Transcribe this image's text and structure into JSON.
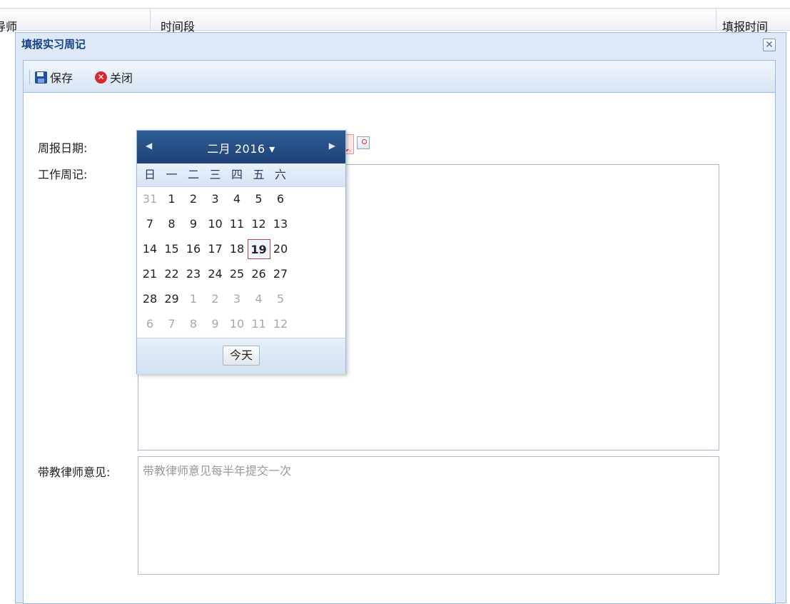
{
  "grid": {
    "columns": [
      "导师",
      "时间段",
      "填报时间"
    ]
  },
  "dialog": {
    "title": "填报实习周记",
    "toolbar": {
      "save_label": "保存",
      "close_label": "关闭"
    },
    "fields": {
      "date_label": "周报日期:",
      "journal_label": "工作周记:",
      "opinion_label": "带教律师意见:",
      "opinion_placeholder": "带教律师意见每半年提交一次"
    }
  },
  "datepicker": {
    "month_label": "二月 2016 ▾",
    "weekdays": [
      "日",
      "一",
      "二",
      "三",
      "四",
      "五",
      "六"
    ],
    "weeks": [
      [
        "31",
        "1",
        "2",
        "3",
        "4",
        "5",
        "6"
      ],
      [
        "7",
        "8",
        "9",
        "10",
        "11",
        "12",
        "13"
      ],
      [
        "14",
        "15",
        "16",
        "17",
        "18",
        "19",
        "20"
      ],
      [
        "21",
        "22",
        "23",
        "24",
        "25",
        "26",
        "27"
      ],
      [
        "28",
        "29",
        "1",
        "2",
        "3",
        "4",
        "5"
      ],
      [
        "6",
        "7",
        "8",
        "9",
        "10",
        "11",
        "12"
      ]
    ],
    "selected_day": "19",
    "today_label": "今天"
  }
}
